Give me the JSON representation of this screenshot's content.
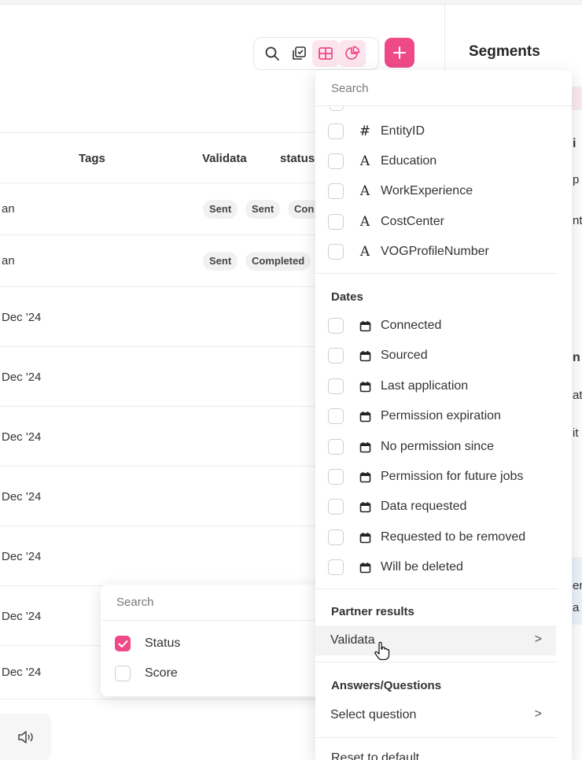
{
  "toolbar": {
    "icons": [
      "search-icon",
      "checklist-icon",
      "table-view-icon",
      "pie-chart-icon"
    ],
    "add_icon": "plus-icon",
    "accent": "#ee4a87"
  },
  "right_panel": {
    "title": "Segments",
    "fragments": [
      "i",
      "p",
      "nt",
      "n",
      "at",
      "it",
      "er",
      "a"
    ]
  },
  "table": {
    "headers": {
      "tags": "Tags",
      "validata": "Validata",
      "status": "status"
    },
    "rows": [
      {
        "name": "an",
        "badges": [
          "Sent",
          "Sent",
          "Con"
        ]
      },
      {
        "name": "an",
        "badges": [
          "Sent",
          "Completed"
        ]
      },
      {
        "name": "Dec '24",
        "badges": []
      },
      {
        "name": "Dec '24",
        "badges": []
      },
      {
        "name": "Dec '24",
        "badges": []
      },
      {
        "name": "Dec '24",
        "badges": []
      },
      {
        "name": "Dec '24",
        "badges": []
      },
      {
        "name": "Dec '24",
        "badges": []
      },
      {
        "name": "Dec '24",
        "badges": []
      }
    ]
  },
  "sound_icon": "speaker-icon",
  "small_popover": {
    "search_placeholder": "Search",
    "items": [
      {
        "label": "Status",
        "checked": true
      },
      {
        "label": "Score",
        "checked": false
      }
    ]
  },
  "dropdown": {
    "search_placeholder": "Search",
    "fields": [
      {
        "icon": "#",
        "label": "EntityID"
      },
      {
        "icon": "A",
        "label": "Education"
      },
      {
        "icon": "A",
        "label": "WorkExperience"
      },
      {
        "icon": "A",
        "label": "CostCenter"
      },
      {
        "icon": "A",
        "label": "VOGProfileNumber"
      }
    ],
    "dates_heading": "Dates",
    "dates": [
      "Connected",
      "Sourced",
      "Last application",
      "Permission expiration",
      "No permission since",
      "Permission for future jobs",
      "Data requested",
      "Requested to be removed",
      "Will be deleted"
    ],
    "partner_heading": "Partner results",
    "partner_item": "Validata",
    "answers_heading": "Answers/Questions",
    "answers_item": "Select question",
    "chevron": ">",
    "reset": "Reset to default"
  }
}
